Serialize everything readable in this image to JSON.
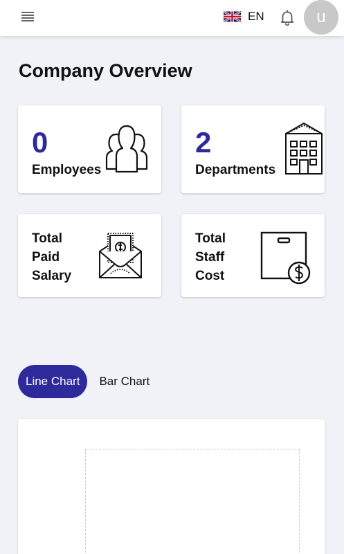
{
  "header": {
    "language_code": "EN",
    "avatar_initial": "u"
  },
  "page": {
    "title": "Company Overview"
  },
  "cards": {
    "employees": {
      "value": "0",
      "label": "Employees"
    },
    "departments": {
      "value": "2",
      "label": "Departments"
    },
    "salary": {
      "line1": "Total",
      "line2": "Paid",
      "line3": "Salary"
    },
    "staff_cost": {
      "line1": "Total",
      "line2": "Staff",
      "line3": "Cost"
    }
  },
  "chart_tabs": {
    "line_label": "Line Chart",
    "bar_label": "Bar Chart",
    "active": "Line Chart"
  },
  "colors": {
    "accent": "#2f2a9c",
    "background": "#f0f2f7",
    "avatar": "#c8c8c8"
  },
  "icons": {
    "menu": "hamburger-icon",
    "language_flag": "uk-flag-icon",
    "notifications": "bell-icon",
    "employees": "people-group-icon",
    "departments": "office-building-icon",
    "salary": "money-envelope-icon",
    "staff_cost": "box-dollar-icon"
  }
}
